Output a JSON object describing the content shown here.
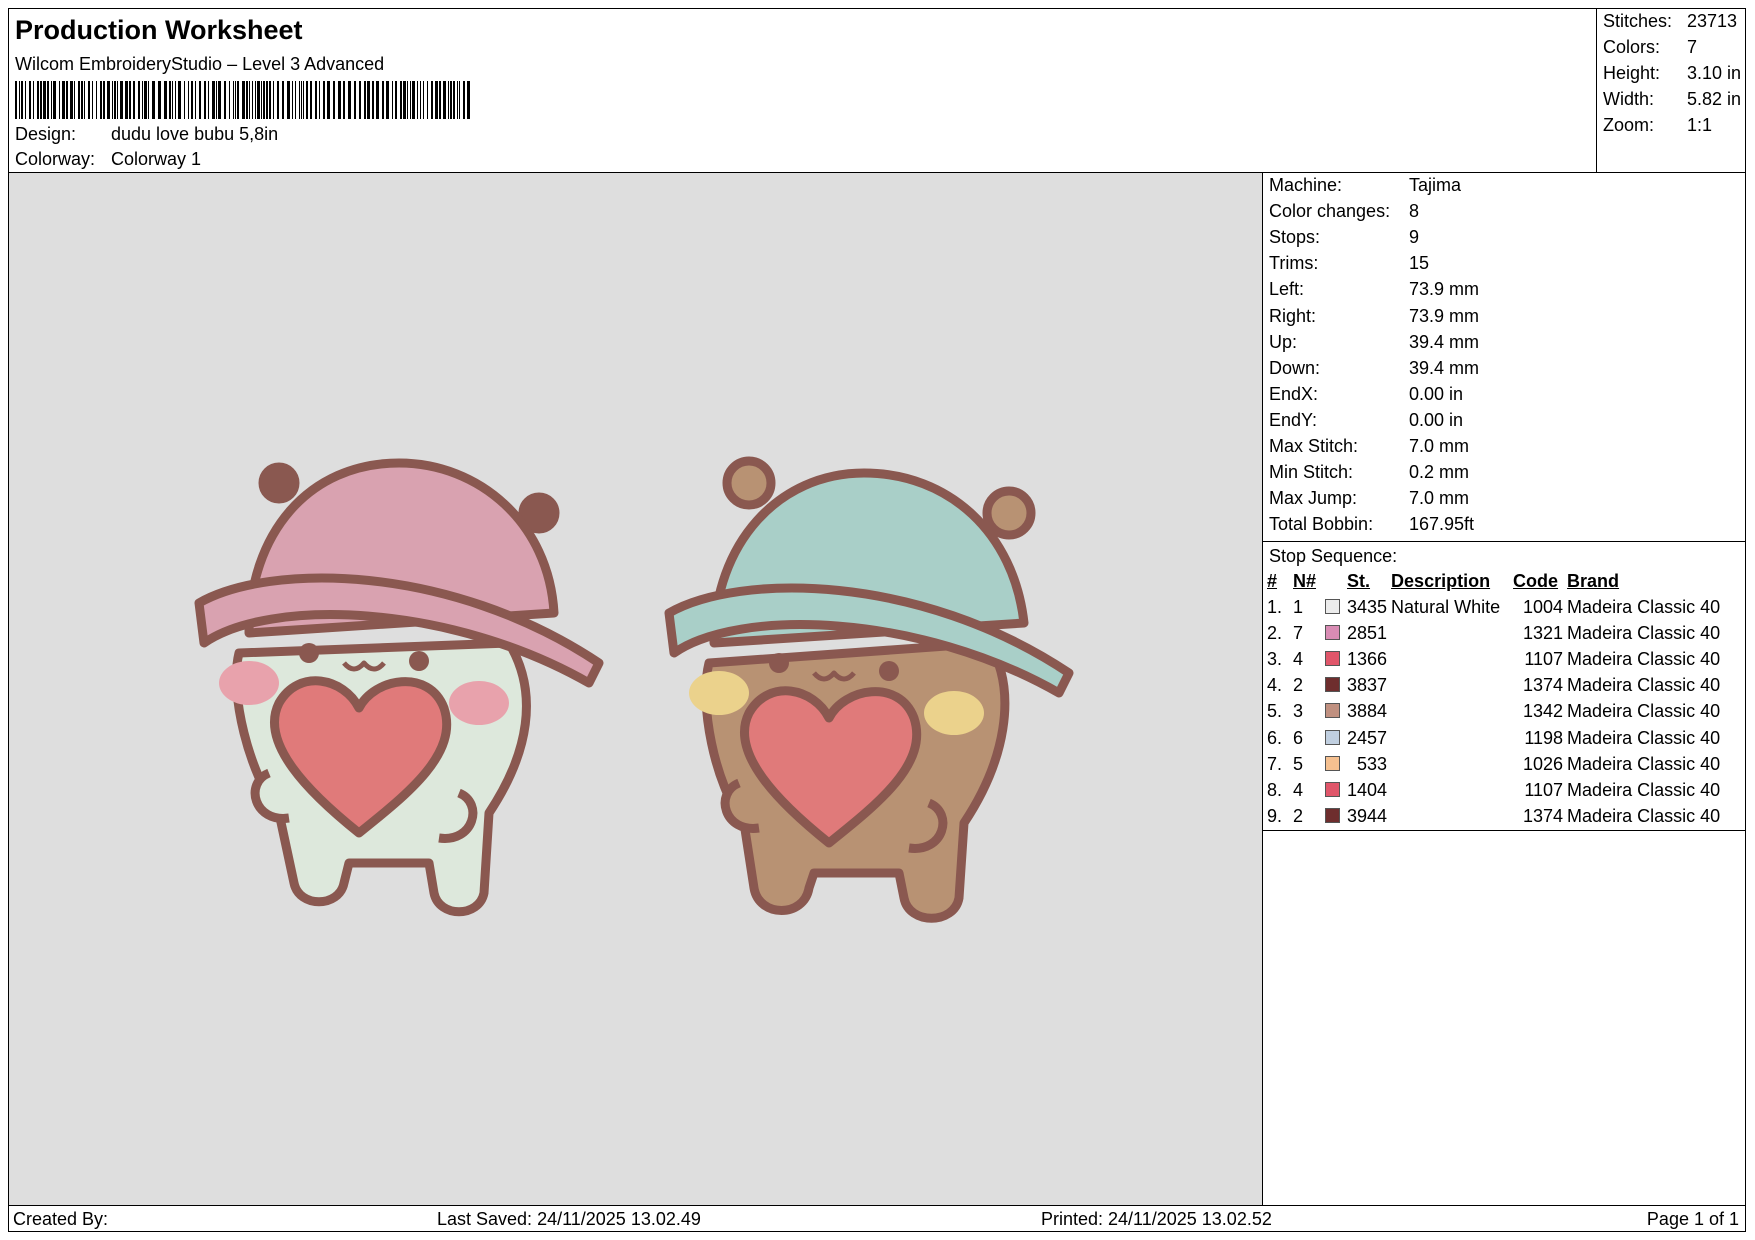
{
  "header": {
    "title": "Production Worksheet",
    "software": "Wilcom EmbroideryStudio – Level 3 Advanced",
    "design_label": "Design:",
    "design_value": "dudu love bubu 5,8in",
    "colorway_label": "Colorway:",
    "colorway_value": "Colorway 1"
  },
  "stats": [
    {
      "label": "Stitches:",
      "value": "23713"
    },
    {
      "label": "Colors:",
      "value": "7"
    },
    {
      "label": "Height:",
      "value": "3.10 in"
    },
    {
      "label": "Width:",
      "value": "5.82 in"
    },
    {
      "label": "Zoom:",
      "value": "1:1"
    }
  ],
  "machine": [
    {
      "label": "Machine:",
      "value": "Tajima"
    },
    {
      "label": "Color changes:",
      "value": "8"
    },
    {
      "label": "Stops:",
      "value": "9"
    },
    {
      "label": "Trims:",
      "value": "15"
    },
    {
      "label": "Left:",
      "value": "73.9 mm"
    },
    {
      "label": "Right:",
      "value": "73.9 mm"
    },
    {
      "label": "Up:",
      "value": "39.4 mm"
    },
    {
      "label": "Down:",
      "value": "39.4 mm"
    },
    {
      "label": "EndX:",
      "value": "0.00 in"
    },
    {
      "label": "EndY:",
      "value": "0.00 in"
    },
    {
      "label": "Max Stitch:",
      "value": "7.0 mm"
    },
    {
      "label": "Min Stitch:",
      "value": "0.2 mm"
    },
    {
      "label": "Max Jump:",
      "value": "7.0 mm"
    },
    {
      "label": "Total Bobbin:",
      "value": "167.95ft"
    }
  ],
  "stop_sequence": {
    "title": "Stop Sequence:",
    "headers": {
      "idx": "#",
      "n": "N#",
      "st": "St.",
      "desc": "Description",
      "code": "Code",
      "brand": "Brand"
    },
    "rows": [
      {
        "idx": "1.",
        "n": "1",
        "color": "#ececec",
        "st": "3435",
        "desc": "Natural White",
        "code": "1004",
        "brand": "Madeira Classic 40"
      },
      {
        "idx": "2.",
        "n": "7",
        "color": "#d98cb4",
        "st": "2851",
        "desc": "",
        "code": "1321",
        "brand": "Madeira Classic 40"
      },
      {
        "idx": "3.",
        "n": "4",
        "color": "#e0566a",
        "st": "1366",
        "desc": "",
        "code": "1107",
        "brand": "Madeira Classic 40"
      },
      {
        "idx": "4.",
        "n": "2",
        "color": "#6e2e2e",
        "st": "3837",
        "desc": "",
        "code": "1374",
        "brand": "Madeira Classic 40"
      },
      {
        "idx": "5.",
        "n": "3",
        "color": "#c09080",
        "st": "3884",
        "desc": "",
        "code": "1342",
        "brand": "Madeira Classic 40"
      },
      {
        "idx": "6.",
        "n": "6",
        "color": "#c0cfe0",
        "st": "2457",
        "desc": "",
        "code": "1198",
        "brand": "Madeira Classic 40"
      },
      {
        "idx": "7.",
        "n": "5",
        "color": "#f5c090",
        "st": "533",
        "desc": "",
        "code": "1026",
        "brand": "Madeira Classic 40"
      },
      {
        "idx": "8.",
        "n": "4",
        "color": "#e0566a",
        "st": "1404",
        "desc": "",
        "code": "1107",
        "brand": "Madeira Classic 40"
      },
      {
        "idx": "9.",
        "n": "2",
        "color": "#6e2e2e",
        "st": "3944",
        "desc": "",
        "code": "1374",
        "brand": "Madeira Classic 40"
      }
    ]
  },
  "footer": {
    "created_by": "Created By:",
    "last_saved": "Last Saved: 24/11/2025 13.02.49",
    "printed": "Printed: 24/11/2025 13.02.52",
    "page": "Page 1 of 1"
  },
  "colors": {
    "outline": "#8a5850",
    "preview_bg": "#dedede",
    "pink_hat": "#d9a2b0",
    "blue_hat": "#a9cfc8",
    "white_body": "#dde8dc",
    "brown_body": "#b89273",
    "heart": "#e07a7a",
    "cheek_pink": "#e8a2ac",
    "cheek_yellow": "#ebd28c"
  }
}
